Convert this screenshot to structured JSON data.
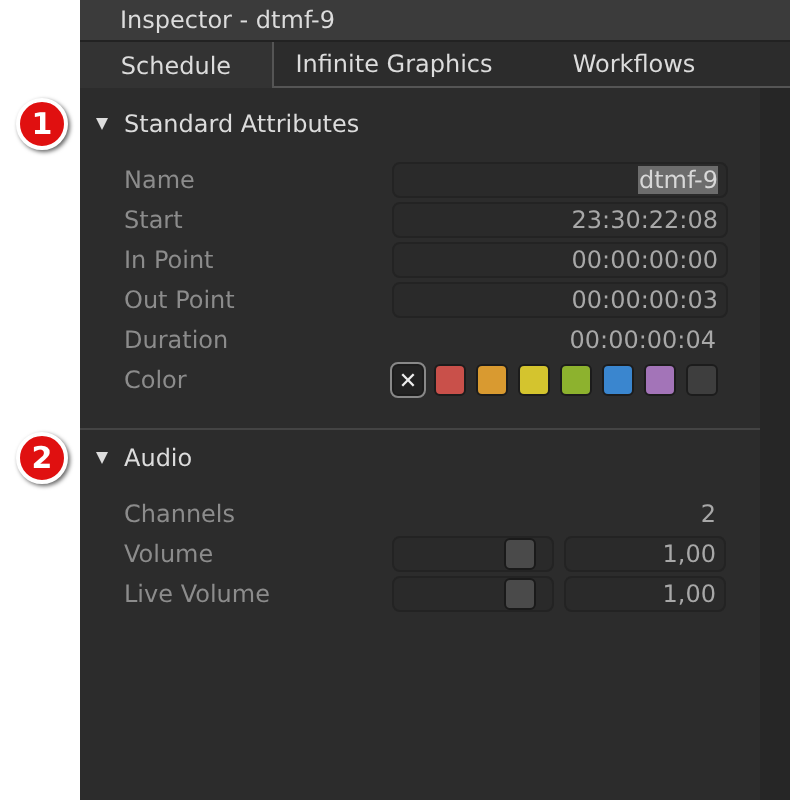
{
  "window": {
    "title": "Inspector - dtmf-9"
  },
  "tabs": [
    {
      "label": "Schedule",
      "selected": true
    },
    {
      "label": "Infinite Graphics",
      "selected": false
    },
    {
      "label": "Workflows",
      "selected": false
    }
  ],
  "sections": [
    {
      "title": "Standard Attributes",
      "expanded": true,
      "callout": "1",
      "rows": [
        {
          "kind": "field",
          "label": "Name",
          "value": "dtmf-9",
          "highlighted": true
        },
        {
          "kind": "field",
          "label": "Start",
          "value": "23:30:22:08",
          "highlighted": false
        },
        {
          "kind": "field",
          "label": "In Point",
          "value": "00:00:00:00",
          "highlighted": false
        },
        {
          "kind": "field",
          "label": "Out Point",
          "value": "00:00:00:03",
          "highlighted": false
        },
        {
          "kind": "plain",
          "label": "Duration",
          "value": "00:00:00:04"
        },
        {
          "kind": "colors",
          "label": "Color",
          "swatches": [
            {
              "label": "✕",
              "selected": true
            },
            {
              "color": "#c9504a",
              "selected": false
            },
            {
              "color": "#d99a30",
              "selected": false
            },
            {
              "color": "#d4c42e",
              "selected": false
            },
            {
              "color": "#8db22e",
              "selected": false
            },
            {
              "color": "#3a86cf",
              "selected": false
            },
            {
              "color": "#a374b8",
              "selected": false
            },
            {
              "color": "#3e3e3e",
              "selected": false
            }
          ]
        }
      ]
    },
    {
      "title": "Audio",
      "expanded": true,
      "callout": "2",
      "rows": [
        {
          "kind": "plain",
          "label": "Channels",
          "value": "2"
        },
        {
          "kind": "slider",
          "label": "Volume",
          "level": 0.9,
          "value": "1,00"
        },
        {
          "kind": "slider",
          "label": "Live Volume",
          "level": 0.9,
          "value": "1,00"
        }
      ]
    }
  ]
}
